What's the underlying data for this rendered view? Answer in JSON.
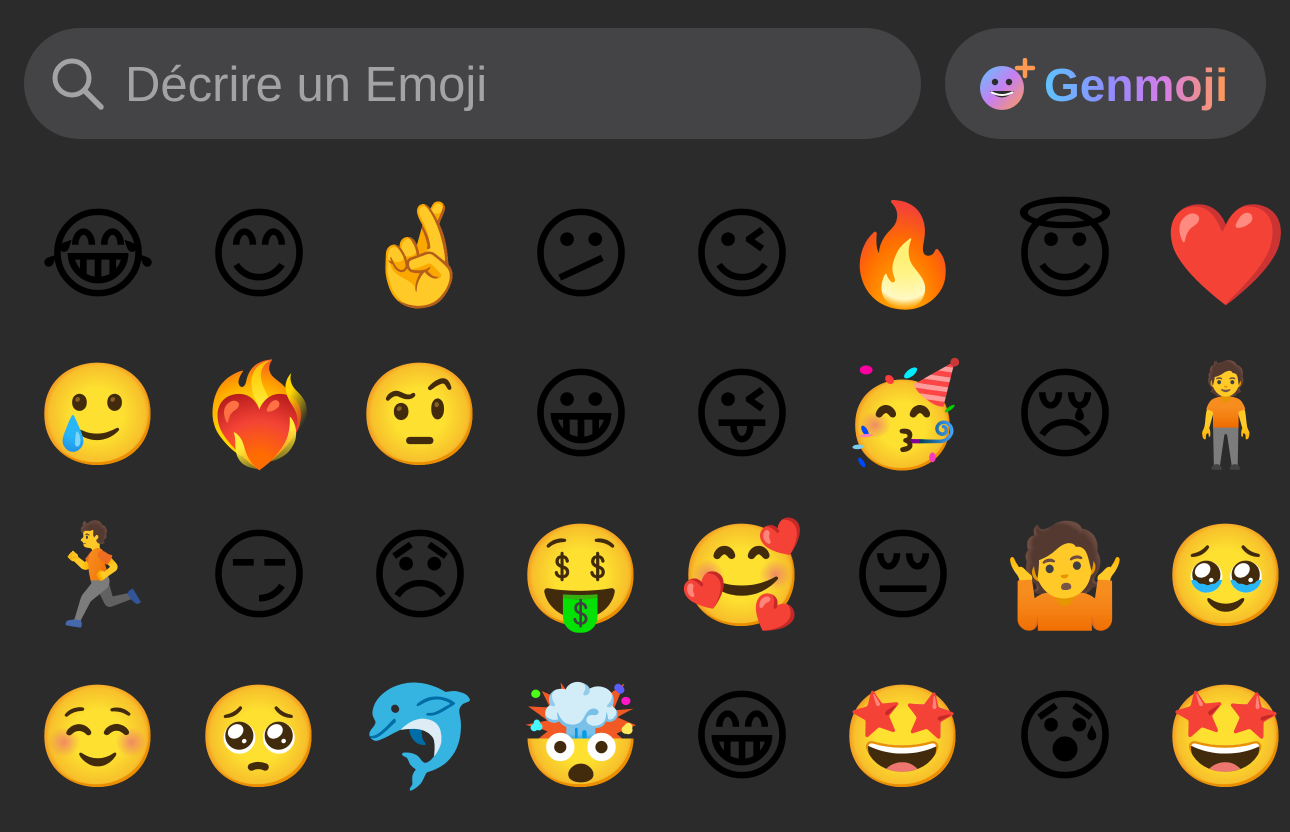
{
  "search": {
    "placeholder": "Décrire un Emoji",
    "icon": "magnifying-glass"
  },
  "genmoji_button": {
    "label": "Genmoji",
    "icon": "genmoji-face-plus",
    "gradient": [
      "#5ec4ff",
      "#8f8cff",
      "#d57de8",
      "#ff9a52"
    ]
  },
  "colors": {
    "background": "#2b2b2c",
    "field": "#444446",
    "placeholder": "#a3a3a6"
  },
  "grid": {
    "rows": [
      [
        {
          "glyph": "😂",
          "name": "tears-of-joy"
        },
        {
          "glyph": "😊",
          "name": "smiling-eyes"
        },
        {
          "glyph": "🤞",
          "name": "memoji-fingers-crossed"
        },
        {
          "glyph": "😕",
          "name": "confused"
        },
        {
          "glyph": "😉",
          "name": "winking"
        },
        {
          "glyph": "🔥",
          "name": "memoji-torch"
        },
        {
          "glyph": "😇",
          "name": "halo"
        },
        {
          "glyph": "❤️",
          "name": "red-heart"
        }
      ],
      [
        {
          "glyph": "🥲",
          "name": "smiling-tear"
        },
        {
          "glyph": "❤️‍🔥",
          "name": "heart-on-fire"
        },
        {
          "glyph": "🤨",
          "name": "raised-eyebrow"
        },
        {
          "glyph": "😀",
          "name": "grinning"
        },
        {
          "glyph": "😜",
          "name": "winking-tongue"
        },
        {
          "glyph": "🥳",
          "name": "partying"
        },
        {
          "glyph": "😢",
          "name": "crying"
        },
        {
          "glyph": "🧍",
          "name": "photo-sticker-man-laughing"
        }
      ],
      [
        {
          "glyph": "🏃",
          "name": "sticker-dancing-person"
        },
        {
          "glyph": "😏",
          "name": "smirking"
        },
        {
          "glyph": "😞",
          "name": "disappointed"
        },
        {
          "glyph": "🤑",
          "name": "memoji-money"
        },
        {
          "glyph": "🥰",
          "name": "smiling-hearts"
        },
        {
          "glyph": "😔",
          "name": "pensive"
        },
        {
          "glyph": "🤷",
          "name": "memoji-sunglasses-shrug"
        },
        {
          "glyph": "🥹",
          "name": "holding-back-tears"
        }
      ],
      [
        {
          "glyph": "☺️",
          "name": "smiling-face"
        },
        {
          "glyph": "🥺",
          "name": "pleading"
        },
        {
          "glyph": "🐬",
          "name": "genmoji-orca"
        },
        {
          "glyph": "🤯",
          "name": "exploding-head"
        },
        {
          "glyph": "😁",
          "name": "beaming"
        },
        {
          "glyph": "🤩",
          "name": "memoji-star-eyes-fire"
        },
        {
          "glyph": "😰",
          "name": "anxious-sweat"
        },
        {
          "glyph": "🤩",
          "name": "star-struck"
        }
      ]
    ]
  }
}
